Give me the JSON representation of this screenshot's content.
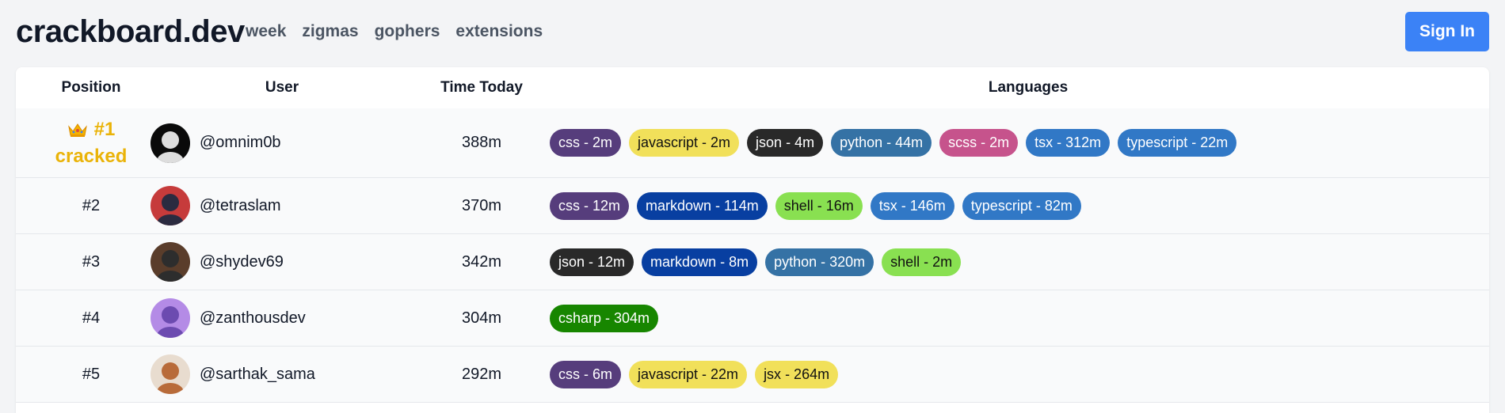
{
  "header": {
    "brand": "crackboard.dev",
    "nav": [
      "week",
      "zigmas",
      "gophers",
      "extensions"
    ],
    "signin_label": "Sign In"
  },
  "table": {
    "columns": [
      "Position",
      "User",
      "Time Today",
      "Languages"
    ],
    "rows": [
      {
        "position": "#1",
        "badge": "cracked",
        "user": "@omnim0b",
        "time": "388m",
        "languages": [
          {
            "label": "css - 2m",
            "bg": "#563d7c",
            "fg": "#ffffff"
          },
          {
            "label": "javascript - 2m",
            "bg": "#f1e05a",
            "fg": "#111111"
          },
          {
            "label": "json - 4m",
            "bg": "#292929",
            "fg": "#ffffff"
          },
          {
            "label": "python - 44m",
            "bg": "#3572a5",
            "fg": "#ffffff"
          },
          {
            "label": "scss - 2m",
            "bg": "#c6538c",
            "fg": "#ffffff"
          },
          {
            "label": "tsx - 312m",
            "bg": "#3178c6",
            "fg": "#ffffff"
          },
          {
            "label": "typescript - 22m",
            "bg": "#3178c6",
            "fg": "#ffffff"
          }
        ]
      },
      {
        "position": "#2",
        "user": "@tetraslam",
        "time": "370m",
        "languages": [
          {
            "label": "css - 12m",
            "bg": "#563d7c",
            "fg": "#ffffff"
          },
          {
            "label": "markdown - 114m",
            "bg": "#083fa1",
            "fg": "#ffffff"
          },
          {
            "label": "shell - 16m",
            "bg": "#89e051",
            "fg": "#111111"
          },
          {
            "label": "tsx - 146m",
            "bg": "#3178c6",
            "fg": "#ffffff"
          },
          {
            "label": "typescript - 82m",
            "bg": "#3178c6",
            "fg": "#ffffff"
          }
        ]
      },
      {
        "position": "#3",
        "user": "@shydev69",
        "time": "342m",
        "languages": [
          {
            "label": "json - 12m",
            "bg": "#292929",
            "fg": "#ffffff"
          },
          {
            "label": "markdown - 8m",
            "bg": "#083fa1",
            "fg": "#ffffff"
          },
          {
            "label": "python - 320m",
            "bg": "#3572a5",
            "fg": "#ffffff"
          },
          {
            "label": "shell - 2m",
            "bg": "#89e051",
            "fg": "#111111"
          }
        ]
      },
      {
        "position": "#4",
        "user": "@zanthousdev",
        "time": "304m",
        "languages": [
          {
            "label": "csharp - 304m",
            "bg": "#178600",
            "fg": "#ffffff"
          }
        ]
      },
      {
        "position": "#5",
        "user": "@sarthak_sama",
        "time": "292m",
        "languages": [
          {
            "label": "css - 6m",
            "bg": "#563d7c",
            "fg": "#ffffff"
          },
          {
            "label": "javascript - 22m",
            "bg": "#f1e05a",
            "fg": "#111111"
          },
          {
            "label": "jsx - 264m",
            "bg": "#f1e05a",
            "fg": "#111111"
          }
        ]
      }
    ]
  }
}
